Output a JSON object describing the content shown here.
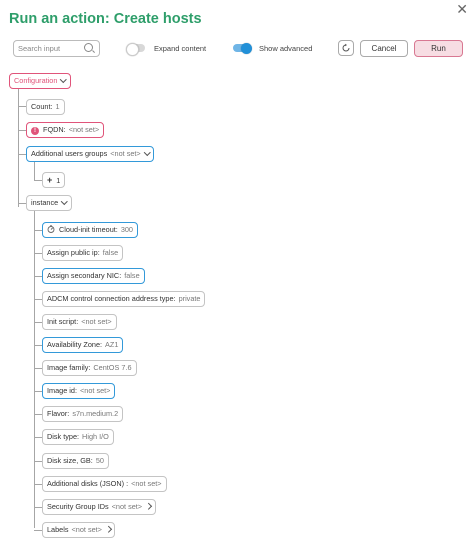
{
  "header": {
    "title": "Run an action: Create hosts",
    "close_icon": "✕"
  },
  "toolbar": {
    "search_placeholder": "Search input",
    "expand_label": "Expand content",
    "expand_on": false,
    "advanced_label": "Show advanced",
    "advanced_on": true,
    "cancel_label": "Cancel",
    "run_label": "Run"
  },
  "tree": {
    "root_label": "Configuration",
    "count": {
      "label": "Count:",
      "value": "1"
    },
    "fqdn": {
      "label": "FQDN:",
      "value": "<not set>"
    },
    "users_groups": {
      "label": "Additional users groups",
      "value": "<not set>",
      "add_count": "1"
    },
    "instance": {
      "label": "instance",
      "fields": [
        {
          "label": "Cloud-init timeout:",
          "value": "300",
          "style": "blue",
          "icon": "timer-icon"
        },
        {
          "label": "Assign public ip:",
          "value": "false",
          "style": "default"
        },
        {
          "label": "Assign secondary NIC:",
          "value": "false",
          "style": "blue"
        },
        {
          "label": "ADCM control connection address type:",
          "value": "private",
          "style": "default"
        },
        {
          "label": "Init script:",
          "value": "<not set>",
          "style": "default"
        },
        {
          "label": "Availability Zone:",
          "value": "AZ1",
          "style": "blue"
        },
        {
          "label": "Image family:",
          "value": "CentOS 7.6",
          "style": "default"
        },
        {
          "label": "Image id:",
          "value": "<not set>",
          "style": "blue"
        },
        {
          "label": "Flavor:",
          "value": "s7n.medium.2",
          "style": "default"
        },
        {
          "label": "Disk type:",
          "value": "High I/O",
          "style": "default"
        },
        {
          "label": "Disk size, GB:",
          "value": "50",
          "style": "default"
        },
        {
          "label": "Additional disks (JSON) :",
          "value": "<not set>",
          "style": "default"
        },
        {
          "label": "Security Group IDs",
          "value": "<not set>",
          "style": "default",
          "chevron": "right"
        },
        {
          "label": "Labels",
          "value": "<not set>",
          "style": "default",
          "chevron": "right"
        }
      ]
    }
  },
  "colors": {
    "title": "#2e9e6a",
    "accent_blue": "#3399d9",
    "accent_pink": "#e0547a",
    "run_bg": "#f7dde3"
  }
}
